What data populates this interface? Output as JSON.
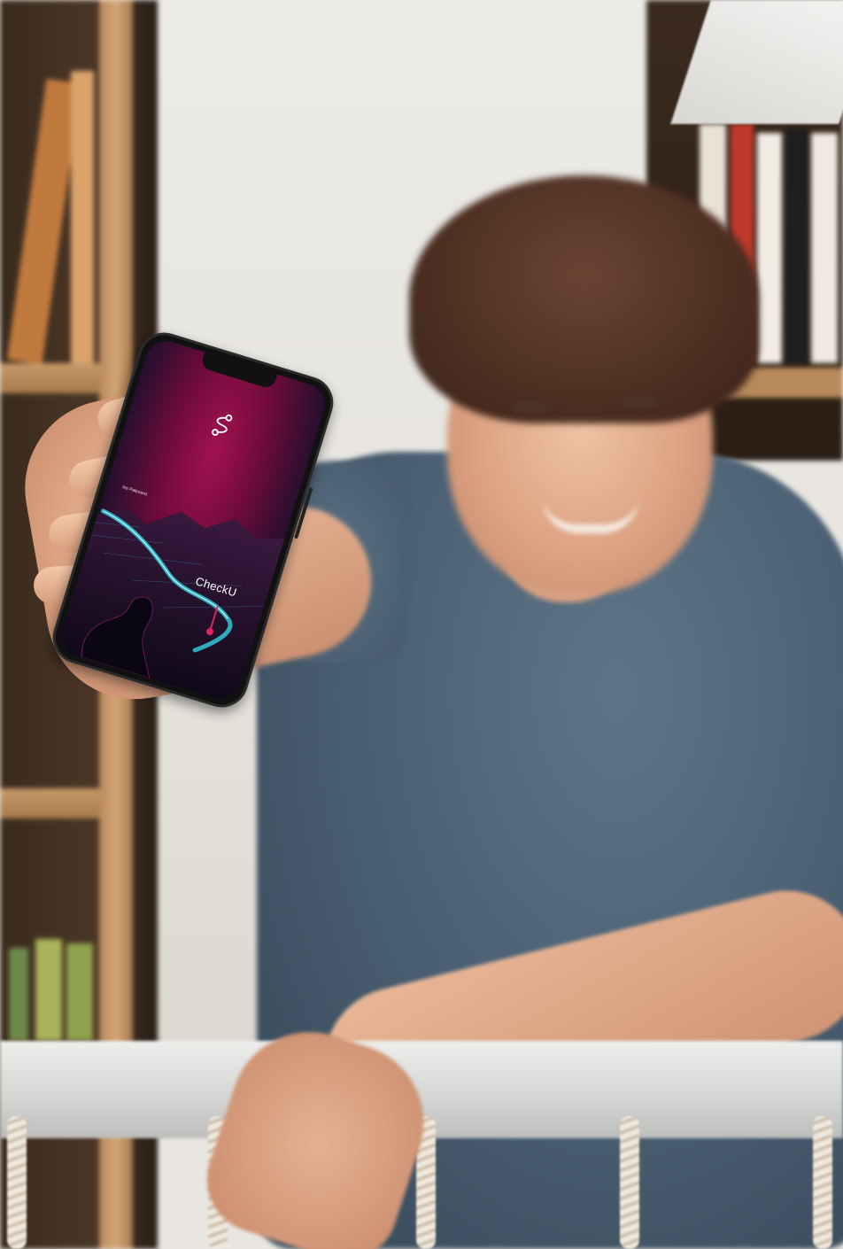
{
  "scene": {
    "description_free": true,
    "phone": {
      "screen": {
        "small_label": "Ins Pakurenz",
        "wordmark": "CheckU",
        "logo_icon": "route-icon"
      },
      "accent_colors": [
        "#a1124f",
        "#2a0f2e",
        "#33c7d6"
      ]
    }
  }
}
